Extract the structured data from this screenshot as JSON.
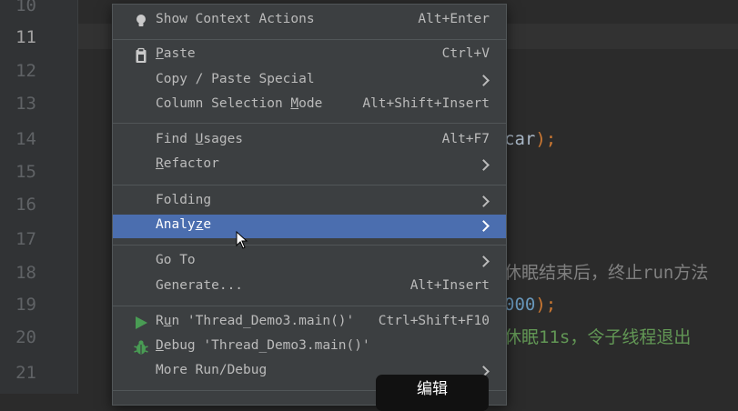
{
  "editor": {
    "line_numbers": [
      "10",
      "11",
      "12",
      "13",
      "14",
      "15",
      "16",
      "17",
      "18",
      "19",
      "20",
      "21"
    ],
    "fragments": {
      "f14a": "car",
      "f14b": ");",
      "f18": "休眠结束后，终止run方法",
      "f19a": "000",
      "f19b": ");",
      "f20": "休眠11s，令子线程退出"
    }
  },
  "menu": {
    "show_context_actions": {
      "label": "Show Context Actions",
      "shortcut": "Alt+Enter"
    },
    "paste": {
      "label_pre": "",
      "label_mn": "P",
      "label_post": "aste",
      "shortcut": "Ctrl+V"
    },
    "copy_paste_special": {
      "label": "Copy / Paste Special"
    },
    "column_selection_mode": {
      "label_pre": "Column Selection ",
      "label_mn": "M",
      "label_post": "ode",
      "shortcut": "Alt+Shift+Insert"
    },
    "find_usages": {
      "label_pre": "Find ",
      "label_mn": "U",
      "label_post": "sages",
      "shortcut": "Alt+F7"
    },
    "refactor": {
      "label_pre": "",
      "label_mn": "R",
      "label_post": "efactor"
    },
    "folding": {
      "label": "Folding"
    },
    "analyze": {
      "label_pre": "Analy",
      "label_mn": "z",
      "label_post": "e"
    },
    "go_to": {
      "label": "Go To"
    },
    "generate": {
      "label": "Generate...",
      "shortcut": "Alt+Insert"
    },
    "run": {
      "label_pre": "R",
      "label_mn": "u",
      "label_post": "n 'Thread_Demo3.main()'",
      "shortcut": "Ctrl+Shift+F10"
    },
    "debug": {
      "label_pre": "",
      "label_mn": "D",
      "label_post": "ebug 'Thread_Demo3.main()'"
    },
    "more_run_debug": {
      "label": "More Run/Debug"
    }
  },
  "tooltip": {
    "text": "编辑"
  },
  "colors": {
    "menu_bg": "#3c3f41",
    "selected": "#4b6eaf",
    "run_green": "#499c54",
    "bulb": "#c9c9c9"
  }
}
